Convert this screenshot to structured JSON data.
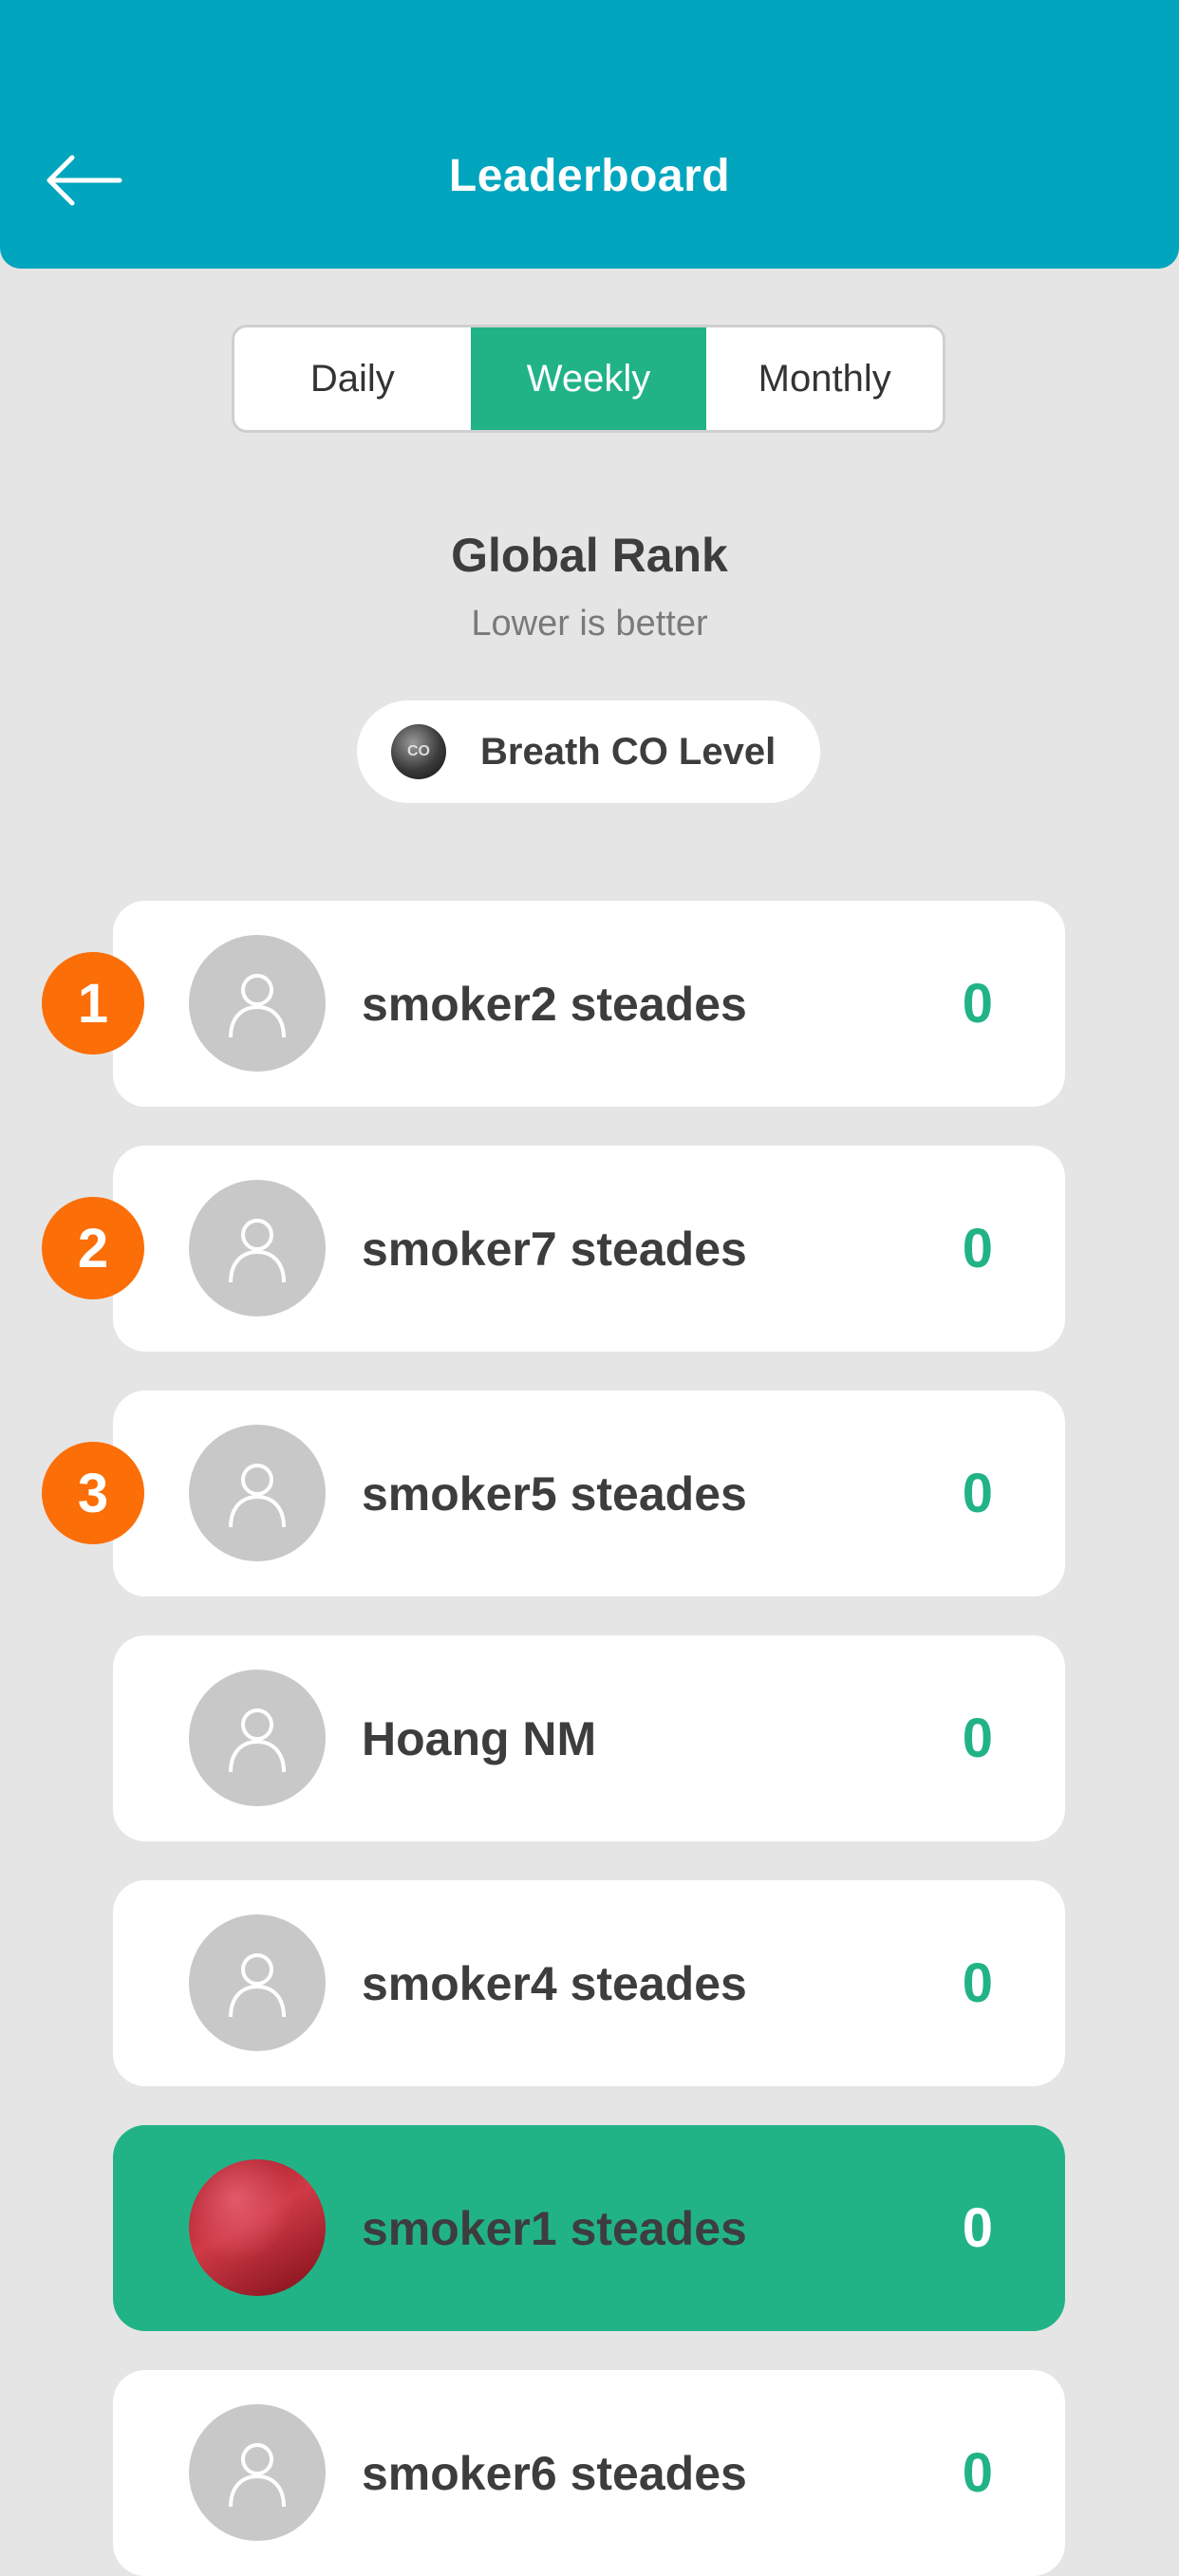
{
  "header": {
    "title": "Leaderboard",
    "back_icon": "arrow-left-icon"
  },
  "period_tabs": [
    {
      "label": "Daily",
      "active": false
    },
    {
      "label": "Weekly",
      "active": true
    },
    {
      "label": "Monthly",
      "active": false
    }
  ],
  "rank": {
    "title": "Global Rank",
    "subtitle": "Lower is better"
  },
  "metric": {
    "label": "Breath CO Level",
    "icon_text": "CO",
    "icon": "co-sensor-icon"
  },
  "colors": {
    "header": "#01a5bd",
    "accent": "#21b386",
    "badge": "#fb6e08",
    "background": "#e5e5e5"
  },
  "entries": [
    {
      "rank": "1",
      "name": "smoker2 steades",
      "score": "0"
    },
    {
      "rank": "2",
      "name": "smoker7 steades",
      "score": "0"
    },
    {
      "rank": "3",
      "name": "smoker5 steades",
      "score": "0"
    },
    {
      "rank": "",
      "name": "Hoang NM",
      "score": "0"
    },
    {
      "rank": "",
      "name": "smoker4 steades",
      "score": "0"
    },
    {
      "rank": "",
      "name": "smoker1 steades",
      "score": "0",
      "current_user": true
    },
    {
      "rank": "",
      "name": "smoker6 steades",
      "score": "0"
    }
  ]
}
